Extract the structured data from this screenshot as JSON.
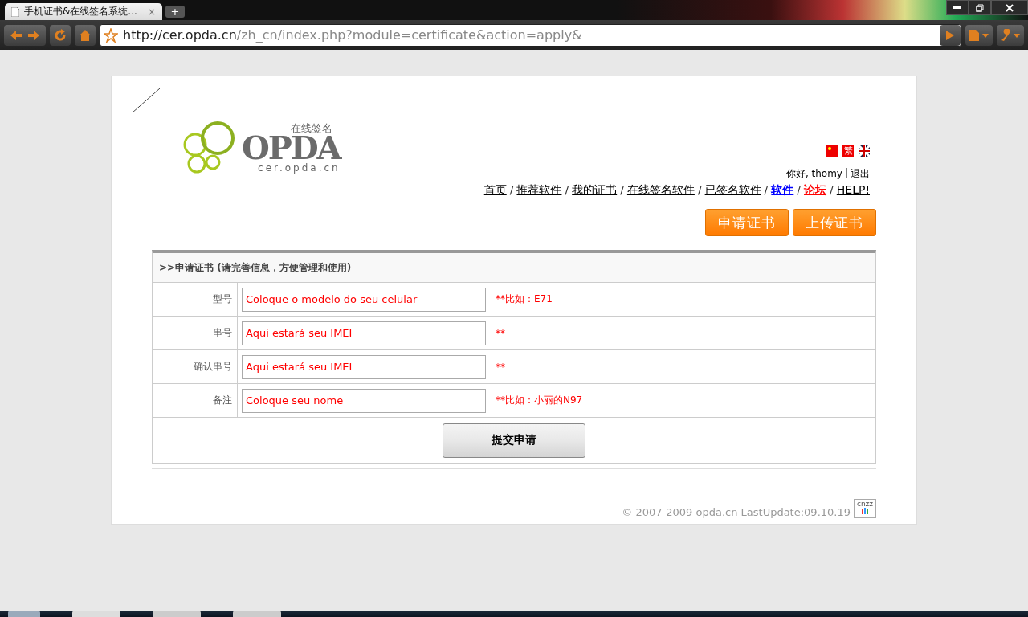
{
  "browser": {
    "tab_title": "手机证书&在线签名系统...",
    "tab_close": "×",
    "new_tab": "+",
    "url_host": "http://cer.opda.cn",
    "url_path": "/zh_cn/index.php?module=certificate&action=apply&"
  },
  "logo": {
    "tagline": "在线签名",
    "name": "OPDA",
    "domain": "cer.opda.cn"
  },
  "languages": [
    {
      "label": "繁",
      "kind": "trad"
    }
  ],
  "user": {
    "greeting": "你好, thomy",
    "separator": "|",
    "logout": "退出"
  },
  "nav": [
    {
      "label": "首页",
      "color": "#000000",
      "bold": false
    },
    {
      "label": "推荐软件",
      "color": "#000000",
      "bold": false
    },
    {
      "label": "我的证书",
      "color": "#000000",
      "bold": false
    },
    {
      "label": "在线签名软件",
      "color": "#000000",
      "bold": false
    },
    {
      "label": "已签名软件",
      "color": "#000000",
      "bold": false
    },
    {
      "label": "软件",
      "color": "#0000ff",
      "bold": true
    },
    {
      "label": "论坛",
      "color": "#ff0000",
      "bold": true
    },
    {
      "label": "HELP!",
      "color": "#000000",
      "bold": false
    }
  ],
  "nav_separator": "/",
  "action_buttons": [
    {
      "label": "申请证书"
    },
    {
      "label": "上传证书"
    }
  ],
  "form": {
    "title": ">>申请证书 (请完善信息，方便管理和使用)",
    "rows": [
      {
        "label": "型号",
        "value": "Coloque o modelo do seu celular",
        "hint": "**比如：E71"
      },
      {
        "label": "串号",
        "value": "Aqui estará seu IMEI",
        "hint": "**"
      },
      {
        "label": "确认串号",
        "value": "Aqui estará seu IMEI",
        "hint": "**"
      },
      {
        "label": "备注",
        "value": "Coloque seu nome",
        "hint": "**比如：小丽的N97"
      }
    ],
    "submit": "提交申请"
  },
  "footer": {
    "copyright": "© 2007-2009 opda.cn LastUpdate:09.10.19",
    "counter_label": "cnzz"
  }
}
